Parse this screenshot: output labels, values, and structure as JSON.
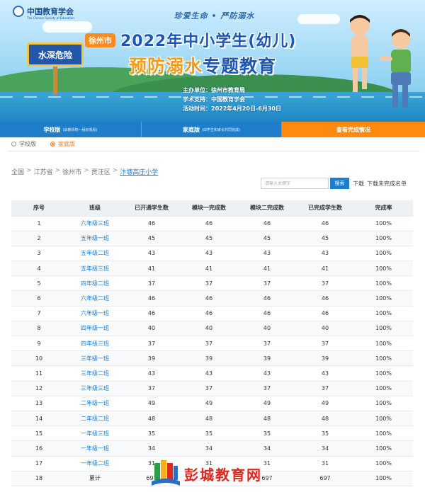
{
  "banner": {
    "logo_text": "中国教育学会",
    "logo_sub": "The Chinese Society of Education",
    "slogan": "珍爱生命 • 严防溺水",
    "city_badge": "徐州市",
    "title": "2022年中小学生(幼儿)",
    "subtitle_hl": "预防溺水",
    "subtitle_rest": "专题教育",
    "sign_text": "水深危险",
    "org": [
      {
        "k": "主办单位：",
        "v": "徐州市教育局"
      },
      {
        "k": "学术支持：",
        "v": "中国教育学会"
      },
      {
        "k": "活动时间：",
        "v": "2022年4月20日-6月30日"
      }
    ],
    "colors": {
      "title": "#1c57b4",
      "highlight": "#f39a17",
      "badge": "#ff8a1e"
    }
  },
  "nav": {
    "tabs": [
      {
        "label": "学校版",
        "note": "(由教师统一组织观看)"
      },
      {
        "label": "家庭版",
        "note": "(由学生和家长共同完成)"
      },
      {
        "label": "查看完成情况",
        "note": ""
      }
    ],
    "active_color": "#ff8a0f"
  },
  "radios": [
    {
      "label": "学校版",
      "checked": false
    },
    {
      "label": "家庭版",
      "checked": true
    }
  ],
  "breadcrumb": [
    "全国",
    "江苏省",
    "徐州市",
    "贾汪区",
    "汴塘高庄小学"
  ],
  "toolbar": {
    "search_placeholder": "请输入关键字",
    "search_button": "搜索",
    "download": "下载",
    "download_incomplete": "下载未完成名单"
  },
  "table": {
    "headers": [
      "序号",
      "班级",
      "已开通学生数",
      "模块一完成数",
      "模块二完成数",
      "已完成学生数",
      "完成率"
    ],
    "rows": [
      [
        "1",
        "六年级三班",
        "46",
        "46",
        "46",
        "46",
        "100%"
      ],
      [
        "2",
        "五年级一班",
        "45",
        "45",
        "45",
        "45",
        "100%"
      ],
      [
        "3",
        "五年级二班",
        "43",
        "43",
        "43",
        "43",
        "100%"
      ],
      [
        "4",
        "五年级三班",
        "41",
        "41",
        "41",
        "41",
        "100%"
      ],
      [
        "5",
        "四年级二班",
        "37",
        "37",
        "37",
        "37",
        "100%"
      ],
      [
        "6",
        "六年级二班",
        "46",
        "46",
        "46",
        "46",
        "100%"
      ],
      [
        "7",
        "六年级一班",
        "46",
        "46",
        "46",
        "46",
        "100%"
      ],
      [
        "8",
        "四年级一班",
        "40",
        "40",
        "40",
        "40",
        "100%"
      ],
      [
        "9",
        "四年级三班",
        "37",
        "37",
        "37",
        "37",
        "100%"
      ],
      [
        "10",
        "三年级一班",
        "39",
        "39",
        "39",
        "39",
        "100%"
      ],
      [
        "11",
        "三年级二班",
        "43",
        "43",
        "43",
        "43",
        "100%"
      ],
      [
        "12",
        "三年级三班",
        "37",
        "37",
        "37",
        "37",
        "100%"
      ],
      [
        "13",
        "二年级一班",
        "49",
        "49",
        "49",
        "49",
        "100%"
      ],
      [
        "14",
        "二年级二班",
        "48",
        "48",
        "48",
        "48",
        "100%"
      ],
      [
        "15",
        "一年级三班",
        "35",
        "35",
        "35",
        "35",
        "100%"
      ],
      [
        "16",
        "一年级一班",
        "34",
        "34",
        "34",
        "34",
        "100%"
      ],
      [
        "17",
        "一年级二班",
        "31",
        "31",
        "31",
        "31",
        "100%"
      ],
      [
        "18",
        "累计",
        "697",
        "697",
        "697",
        "697",
        "100%"
      ]
    ]
  },
  "watermark": "彭城教育网"
}
